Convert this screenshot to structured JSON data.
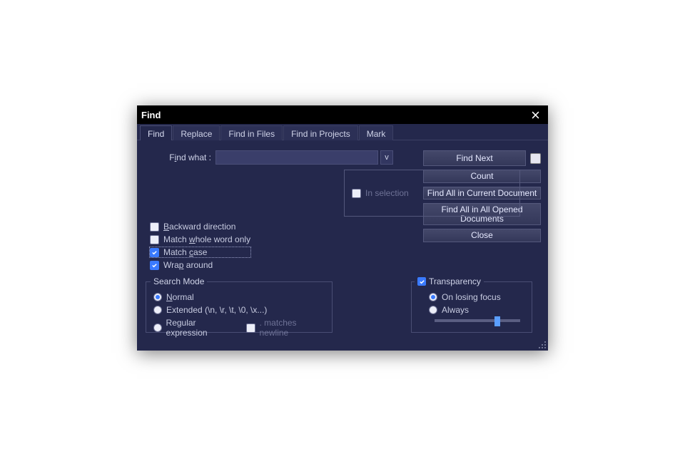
{
  "title": "Find",
  "tabs": [
    "Find",
    "Replace",
    "Find in Files",
    "Find in Projects",
    "Mark"
  ],
  "activeTab": 0,
  "findLabel_pre": "F",
  "findLabel_u": "i",
  "findLabel_post": "nd what :",
  "findValue": "",
  "comboGlyph": "v",
  "buttons": {
    "findNext": "Find Next",
    "count": "Count",
    "findAllCurrent": "Find All in Current Document",
    "findAllOpened": "Find All in All Opened Documents",
    "close": "Close"
  },
  "inSelection": "In selection",
  "checks": {
    "backward_pre": "",
    "backward_u": "B",
    "backward_post": "ackward direction",
    "whole_pre": "Match ",
    "whole_u": "w",
    "whole_post": "hole word only",
    "case_pre": "Match ",
    "case_u": "c",
    "case_post": "ase",
    "wrap_pre": "Wra",
    "wrap_u": "p",
    "wrap_post": " around"
  },
  "checked": {
    "backward": false,
    "whole": false,
    "case": true,
    "wrap": true
  },
  "searchMode": {
    "legend": "Search Mode",
    "normal_u": "N",
    "normal_post": "ormal",
    "extended_u": "",
    "extended": "Extended (\\n, \\r, \\t, \\0, \\x...)",
    "regex": "Regular expression",
    "matchesNewline": ". matches newline",
    "selected": "normal"
  },
  "transparency": {
    "legend": "Transparency",
    "enabled": true,
    "onLosing": "On losing focus",
    "always": "Always",
    "selected": "onLosing",
    "sliderPercent": 70
  }
}
